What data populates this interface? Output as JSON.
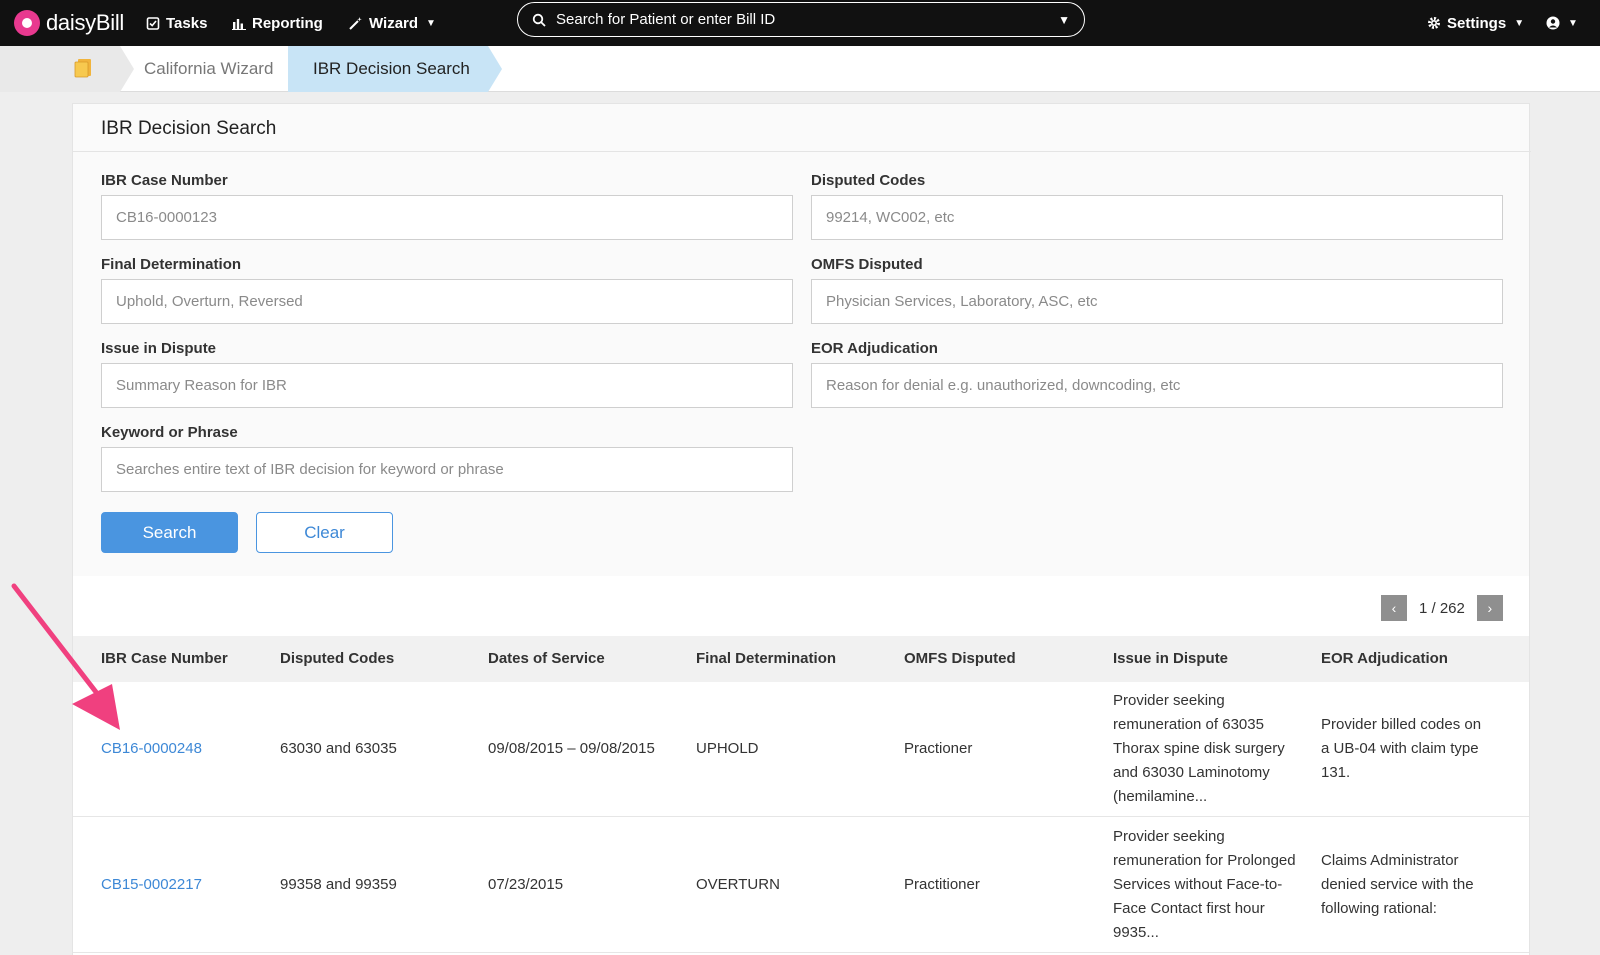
{
  "app": {
    "logo_text": "daisyBill",
    "brand_color": "#e8398f"
  },
  "nav": {
    "tasks": "Tasks",
    "reporting": "Reporting",
    "wizard": "Wizard",
    "search_placeholder": "Search for Patient or enter Bill ID",
    "settings": "Settings"
  },
  "breadcrumb": {
    "items": [
      "California Wizard",
      "IBR Decision Search"
    ]
  },
  "form": {
    "title": "IBR Decision Search",
    "fields": {
      "case_number": {
        "label": "IBR Case Number",
        "placeholder": "CB16-0000123"
      },
      "disputed_codes": {
        "label": "Disputed Codes",
        "placeholder": "99214, WC002, etc"
      },
      "final_determination": {
        "label": "Final Determination",
        "placeholder": "Uphold, Overturn, Reversed"
      },
      "omfs_disputed": {
        "label": "OMFS Disputed",
        "placeholder": "Physician Services, Laboratory, ASC, etc"
      },
      "issue_in_dispute": {
        "label": "Issue in Dispute",
        "placeholder": "Summary Reason for IBR"
      },
      "eor_adjudication": {
        "label": "EOR Adjudication",
        "placeholder": "Reason for denial e.g. unauthorized, downcoding, etc"
      },
      "keyword": {
        "label": "Keyword or Phrase",
        "placeholder": "Searches entire text of IBR decision for keyword or phrase"
      }
    },
    "search_button": "Search",
    "clear_button": "Clear"
  },
  "pager": {
    "text": "1 / 262",
    "prev": "‹",
    "next": "›"
  },
  "table": {
    "headers": [
      "IBR Case Number",
      "Disputed Codes",
      "Dates of Service",
      "Final Determination",
      "OMFS Disputed",
      "Issue in Dispute",
      "EOR Adjudication"
    ],
    "rows": [
      {
        "case_number": "CB16-0000248",
        "disputed_codes": "63030 and 63035",
        "dates": "09/08/2015 – 09/08/2015",
        "determination": "UPHOLD",
        "omfs": "Practioner",
        "issue_lines": [
          "Provider seeking",
          "remuneration of 63035",
          "Thorax spine disk surgery",
          "and 63030 Laminotomy",
          "(hemilamine..."
        ],
        "eor_lines": [
          "Provider billed codes on",
          "a UB-04 with claim type",
          "131."
        ]
      },
      {
        "case_number": "CB15-0002217",
        "disputed_codes": "99358 and 99359",
        "dates": "07/23/2015",
        "determination": "OVERTURN",
        "omfs": "Practitioner",
        "issue_lines": [
          "Provider seeking",
          "remuneration for Prolonged",
          "Services without Face-to-",
          "Face Contact first hour",
          "9935..."
        ],
        "eor_lines": [
          "Claims Administrator",
          "denied service with the",
          "following rational:"
        ]
      }
    ]
  },
  "annotation": {
    "arrow_color": "#f0407f"
  }
}
